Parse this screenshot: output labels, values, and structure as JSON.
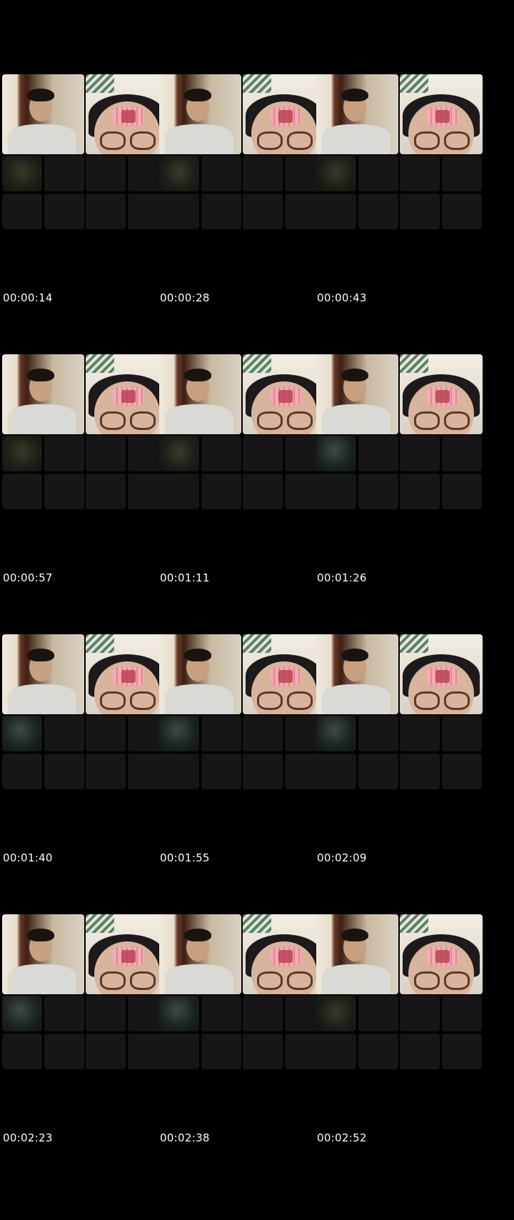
{
  "frames": [
    {
      "timestamp": "00:00:14",
      "thumb": "dark"
    },
    {
      "timestamp": "00:00:28",
      "thumb": "dark"
    },
    {
      "timestamp": "00:00:43",
      "thumb": "dark"
    },
    {
      "timestamp": "00:00:57",
      "thumb": "dark"
    },
    {
      "timestamp": "00:01:11",
      "thumb": "dark"
    },
    {
      "timestamp": "00:01:26",
      "thumb": "lit"
    },
    {
      "timestamp": "00:01:40",
      "thumb": "lit"
    },
    {
      "timestamp": "00:01:55",
      "thumb": "lit"
    },
    {
      "timestamp": "00:02:09",
      "thumb": "lit"
    },
    {
      "timestamp": "00:02:23",
      "thumb": "lit"
    },
    {
      "timestamp": "00:02:38",
      "thumb": "lit"
    },
    {
      "timestamp": "00:02:52",
      "thumb": "dark"
    }
  ],
  "colors": {
    "background": "#000000",
    "empty_tile": "#151615",
    "timestamp_text": "#ffffff"
  }
}
